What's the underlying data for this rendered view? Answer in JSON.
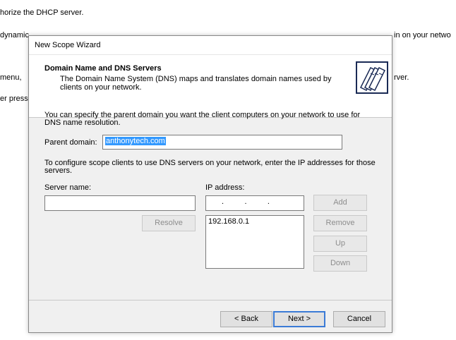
{
  "background": {
    "line1": "horize the DHCP server.",
    "line2a": "dynamic",
    "line2b": "in on your netwo",
    "line3a": " menu,",
    "line3b": "rver.",
    "line4": "er press"
  },
  "window": {
    "title": "New Scope Wizard"
  },
  "header": {
    "title": "Domain Name and DNS Servers",
    "description": "The Domain Name System (DNS) maps and translates domain names used by clients on your network."
  },
  "content": {
    "intro": "You can specify the parent domain you want the client computers on your network to use for DNS name resolution.",
    "parent_domain_label": "Parent domain:",
    "parent_domain_value": "anthonytech.com",
    "scope_text": "To configure scope clients to use DNS servers on your network, enter the IP addresses for those servers.",
    "server_name_label": "Server name:",
    "server_name_value": "",
    "ip_label": "IP address:",
    "ip_placeholder": ".       .       .",
    "ip_list": [
      "192.168.0.1"
    ]
  },
  "buttons": {
    "resolve": "Resolve",
    "add": "Add",
    "remove": "Remove",
    "up": "Up",
    "down": "Down",
    "back": "< Back",
    "next": "Next >",
    "cancel": "Cancel"
  },
  "icons": {
    "header": "folders-icon"
  },
  "colors": {
    "selection": "#3399ff",
    "default_button_border": "#3b7bd6"
  }
}
